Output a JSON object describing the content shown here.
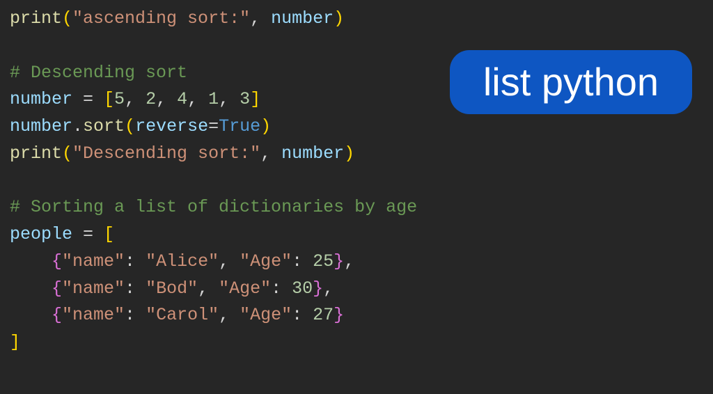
{
  "badge": {
    "label": "list python"
  },
  "code": {
    "l1_fn": "print",
    "l1_str": "\"ascending sort:\"",
    "l1_var": "number",
    "l3_comment": "# Descending sort",
    "l4_var": "number",
    "l4_nums": [
      "5",
      "2",
      "4",
      "1",
      "3"
    ],
    "l5_obj": "number",
    "l5_method": "sort",
    "l5_kwarg": "reverse",
    "l5_val": "True",
    "l6_fn": "print",
    "l6_str": "\"Descending sort:\"",
    "l6_var": "number",
    "l8_comment": "# Sorting a list of dictionaries by age",
    "l9_var": "people",
    "dict_entries": [
      {
        "k1": "\"name\"",
        "v1": "\"Alice\"",
        "k2": "\"Age\"",
        "v2": "25"
      },
      {
        "k1": "\"name\"",
        "v1": "\"Bod\"",
        "k2": "\"Age\"",
        "v2": "30"
      },
      {
        "k1": "\"name\"",
        "v1": "\"Carol\"",
        "k2": "\"Age\"",
        "v2": "27"
      }
    ]
  }
}
